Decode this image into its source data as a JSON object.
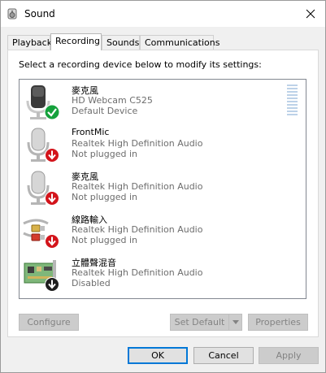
{
  "window": {
    "title": "Sound",
    "icon": "speaker-icon"
  },
  "tabs": [
    {
      "label": "Playback",
      "active": false
    },
    {
      "label": "Recording",
      "active": true
    },
    {
      "label": "Sounds",
      "active": false
    },
    {
      "label": "Communications",
      "active": false
    }
  ],
  "panel": {
    "instruction": "Select a recording device below to modify its settings:"
  },
  "devices": [
    {
      "name": "麥克風",
      "description": "HD Webcam C525",
      "status": "Default Device",
      "icon": "webcam-microphone-icon",
      "badge": "green-check-icon"
    },
    {
      "name": "FrontMic",
      "description": "Realtek High Definition Audio",
      "status": "Not plugged in",
      "icon": "microphone-icon",
      "badge": "red-down-arrow-icon"
    },
    {
      "name": "麥克風",
      "description": "Realtek High Definition Audio",
      "status": "Not plugged in",
      "icon": "microphone-icon",
      "badge": "red-down-arrow-icon"
    },
    {
      "name": "線路輸入",
      "description": "Realtek High Definition Audio",
      "status": "Not plugged in",
      "icon": "line-in-cable-icon",
      "badge": "red-down-arrow-icon"
    },
    {
      "name": "立體聲混音",
      "description": "Realtek High Definition Audio",
      "status": "Disabled",
      "icon": "sound-card-icon",
      "badge": "black-down-arrow-icon"
    }
  ],
  "buttons": {
    "configure": "Configure",
    "set_default": "Set Default",
    "properties": "Properties",
    "ok": "OK",
    "cancel": "Cancel",
    "apply": "Apply"
  },
  "colors": {
    "accent": "#0078d7",
    "success": "#15a13c",
    "error": "#d3141b",
    "disabled_text": "#838383"
  }
}
